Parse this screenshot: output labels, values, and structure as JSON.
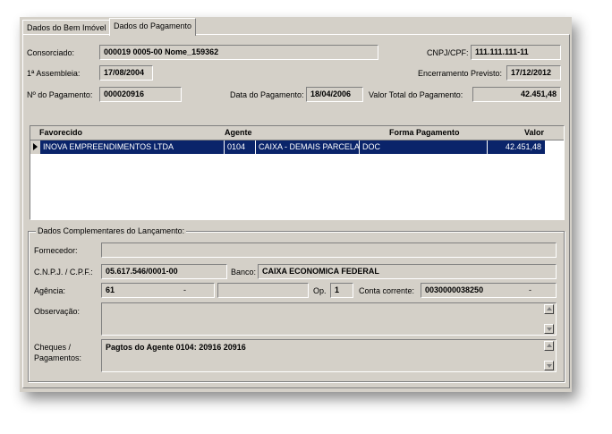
{
  "tabs": [
    {
      "label": "Dados do Bem Imóvel"
    },
    {
      "label": "Dados do Pagamento"
    }
  ],
  "form": {
    "consorciado": {
      "label": "Consorciado:",
      "value": "000019 0005-00  Nome_159362"
    },
    "cnpj_cpf": {
      "label": "CNPJ/CPF:",
      "value": "111.111.111-11"
    },
    "assembleia": {
      "label": "1ª  Assembleia:",
      "value": "17/08/2004"
    },
    "encerramento": {
      "label": "Encerramento Previsto:",
      "value": "17/12/2012"
    },
    "num_pagamento": {
      "label": "Nº do Pagamento:",
      "value": "000020916"
    },
    "data_pagamento": {
      "label": "Data do Pagamento:",
      "value": "18/04/2006"
    },
    "valor_total": {
      "label": "Valor Total do Pagamento:",
      "value": "42.451,48"
    }
  },
  "grid": {
    "columns": [
      "Favorecido",
      "Agente",
      "Forma Pagamento",
      "Valor"
    ],
    "rows": [
      {
        "favorecido": "INOVA EMPREENDIMENTOS LTDA",
        "agente": "0104",
        "agente_desc": "CAIXA - DEMAIS PARCELAS",
        "forma": "DOC",
        "valor": "42.451,48"
      }
    ]
  },
  "complementares": {
    "title": "Dados Complementares do Lançamento:",
    "fornecedor": {
      "label": "Fornecedor:",
      "value": ""
    },
    "cnpj_cpf": {
      "label": "C.N.P.J. / C.P.F.:",
      "value": "05.617.546/0001-00"
    },
    "banco": {
      "label": "Banco:",
      "value": "CAIXA ECONOMICA FEDERAL"
    },
    "agencia": {
      "label": "Agência:",
      "value": "61",
      "digit": "-"
    },
    "op": {
      "label": "Op.",
      "value": "1"
    },
    "conta": {
      "label": "Conta corrente:",
      "value": "0030000038250",
      "digit": "-"
    },
    "observacao": {
      "label": "Observação:",
      "value": ""
    },
    "cheques": {
      "label_line1": "Cheques /",
      "label_line2": "Pagamentos:",
      "value": "Pagtos do Agente 0104: 20916 20916"
    }
  }
}
